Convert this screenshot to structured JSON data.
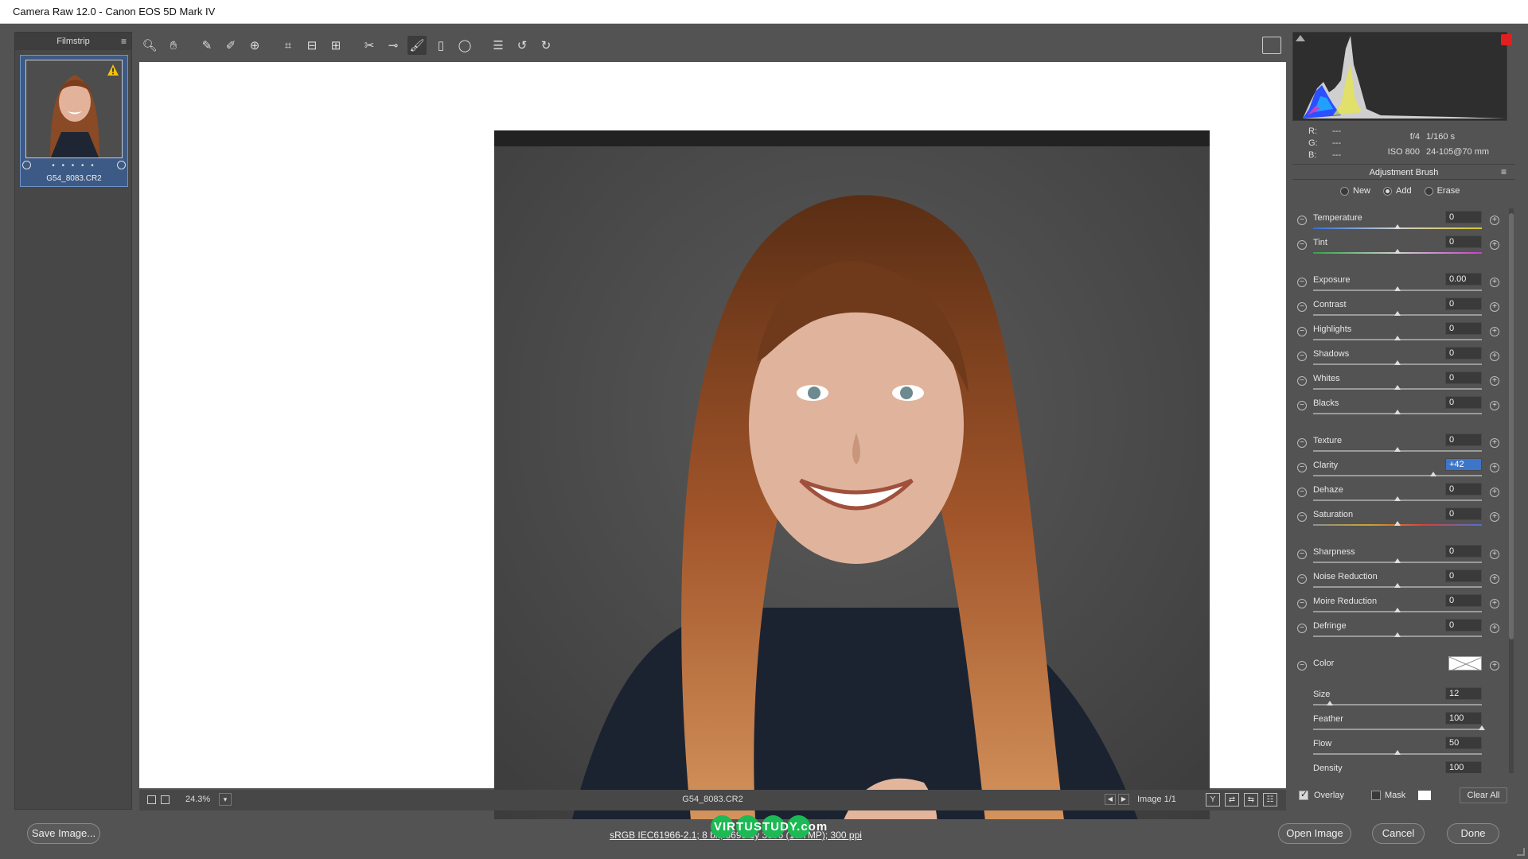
{
  "window": {
    "title": "Camera Raw 12.0  -  Canon EOS 5D Mark IV"
  },
  "filmstrip": {
    "title": "Filmstrip",
    "items": [
      {
        "name": "G54_8083.CR2",
        "rating_dots": "• • • • •"
      }
    ]
  },
  "toolbar": {
    "tools": [
      "zoom-tool",
      "hand-tool",
      "white-balance-tool",
      "color-sampler-tool",
      "targeted-adjustment-tool",
      "crop-tool",
      "straighten-tool",
      "transform-tool",
      "spot-removal-tool",
      "red-eye-tool",
      "adjustment-brush-tool",
      "graduated-filter-tool",
      "radial-filter-tool",
      "preferences",
      "rotate-left",
      "rotate-right"
    ],
    "active": "adjustment-brush-tool"
  },
  "status": {
    "zoom": "24.3%",
    "filename": "G54_8083.CR2",
    "image_count": "Image 1/1"
  },
  "histogram": {
    "rgb": {
      "r_label": "R:",
      "g_label": "G:",
      "b_label": "B:",
      "r": "---",
      "g": "---",
      "b": "---"
    },
    "exif": {
      "aperture": "f/4",
      "shutter": "1/160 s",
      "iso": "ISO 800",
      "lens": "24-105@70 mm"
    }
  },
  "panel": {
    "title": "Adjustment Brush",
    "modes": [
      {
        "label": "New",
        "checked": false
      },
      {
        "label": "Add",
        "checked": true
      },
      {
        "label": "Erase",
        "checked": false
      }
    ],
    "sliders": [
      {
        "label": "Temperature",
        "value": "0",
        "pos": 0.5,
        "track": "temp"
      },
      {
        "label": "Tint",
        "value": "0",
        "pos": 0.5,
        "track": "tint"
      },
      {
        "label": "Exposure",
        "value": "0.00",
        "pos": 0.5
      },
      {
        "label": "Contrast",
        "value": "0",
        "pos": 0.5
      },
      {
        "label": "Highlights",
        "value": "0",
        "pos": 0.5
      },
      {
        "label": "Shadows",
        "value": "0",
        "pos": 0.5
      },
      {
        "label": "Whites",
        "value": "0",
        "pos": 0.5
      },
      {
        "label": "Blacks",
        "value": "0",
        "pos": 0.5
      },
      {
        "label": "Texture",
        "value": "0",
        "pos": 0.5
      },
      {
        "label": "Clarity",
        "value": "+42",
        "pos": 0.71,
        "selected": true
      },
      {
        "label": "Dehaze",
        "value": "0",
        "pos": 0.5
      },
      {
        "label": "Saturation",
        "value": "0",
        "pos": 0.5,
        "track": "sat"
      },
      {
        "label": "Sharpness",
        "value": "0",
        "pos": 0.5
      },
      {
        "label": "Noise Reduction",
        "value": "0",
        "pos": 0.5
      },
      {
        "label": "Moire Reduction",
        "value": "0",
        "pos": 0.5
      },
      {
        "label": "Defringe",
        "value": "0",
        "pos": 0.5
      },
      {
        "label": "Color",
        "is_color": true
      },
      {
        "label": "Size",
        "value": "12",
        "pos": 0.1,
        "no_buttons": true
      },
      {
        "label": "Feather",
        "value": "100",
        "pos": 1.0,
        "no_buttons": true
      },
      {
        "label": "Flow",
        "value": "50",
        "pos": 0.5,
        "no_buttons": true
      },
      {
        "label": "Density",
        "value": "100",
        "pos": 1.0,
        "no_buttons": true
      }
    ],
    "overlay": {
      "label": "Overlay",
      "checked": true
    },
    "mask": {
      "label": "Mask",
      "checked": false
    },
    "clear_all": "Clear All"
  },
  "footer": {
    "save_image": "Save Image...",
    "workflow": "sRGB IEC61966-2.1; 8 bit; 3696 by 3696 (13.7MP); 300 ppi",
    "open_image": "Open Image",
    "cancel": "Cancel",
    "done": "Done",
    "watermark": "VIRTUSTUDY.com"
  },
  "colors": {
    "accent": "#3d75c9",
    "clip_warning": "#e21f1f",
    "watermark": "#1db954"
  }
}
